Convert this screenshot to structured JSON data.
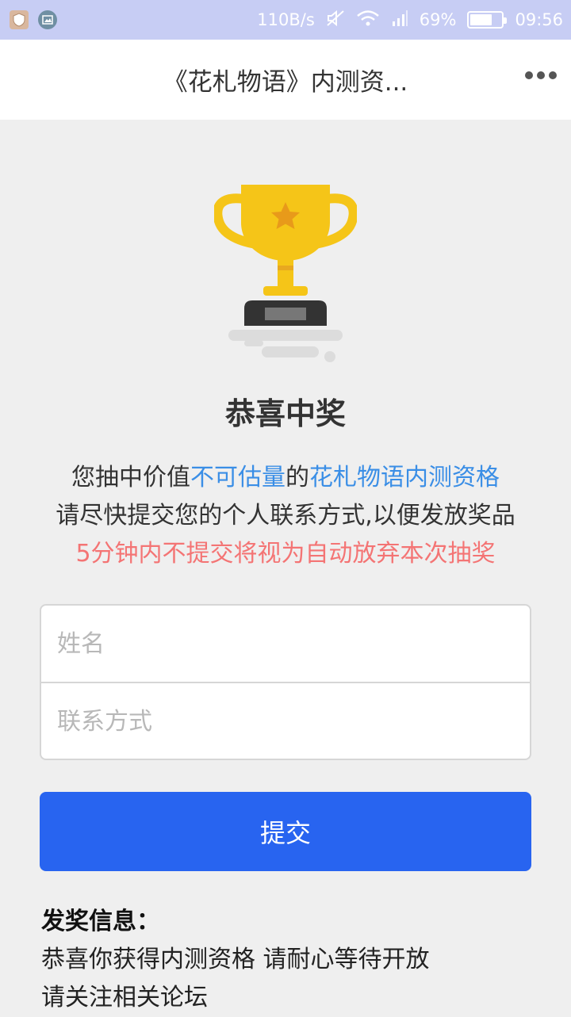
{
  "status_bar": {
    "net_speed": "110B/s",
    "battery_percent": "69%",
    "battery_level": 0.69,
    "time": "09:56",
    "icons": [
      "shield-app-icon",
      "image-app-icon",
      "mute-icon",
      "wifi-icon",
      "signal-icon",
      "battery-icon"
    ]
  },
  "title_bar": {
    "title": "《花札物语》内测资...",
    "more_icon": "more-dots-icon"
  },
  "main": {
    "trophy_icon": "trophy-icon",
    "heading": "恭喜中奖",
    "line1_a": "您抽中价值",
    "line1_b": "不可估量",
    "line1_c": "的",
    "line1_d": "花札物语内测资格",
    "line2": "请尽快提交您的个人联系方式,以便发放奖品",
    "line3": "5分钟内不提交将视为自动放弃本次抽奖"
  },
  "form": {
    "name_placeholder": "姓名",
    "name_value": "",
    "contact_placeholder": "联系方式",
    "contact_value": "",
    "submit_label": "提交"
  },
  "info": {
    "title": "发奖信息：",
    "line1": "恭喜你获得内测资格 请耐心等待开放",
    "line2": "请关注相关论坛"
  },
  "colors": {
    "status_bar_bg": "#c7cdf4",
    "page_bg": "#efefef",
    "link_blue": "#3a8ee6",
    "warning_red": "#f47474",
    "button_blue": "#2864f0",
    "trophy_gold": "#f5c518"
  }
}
